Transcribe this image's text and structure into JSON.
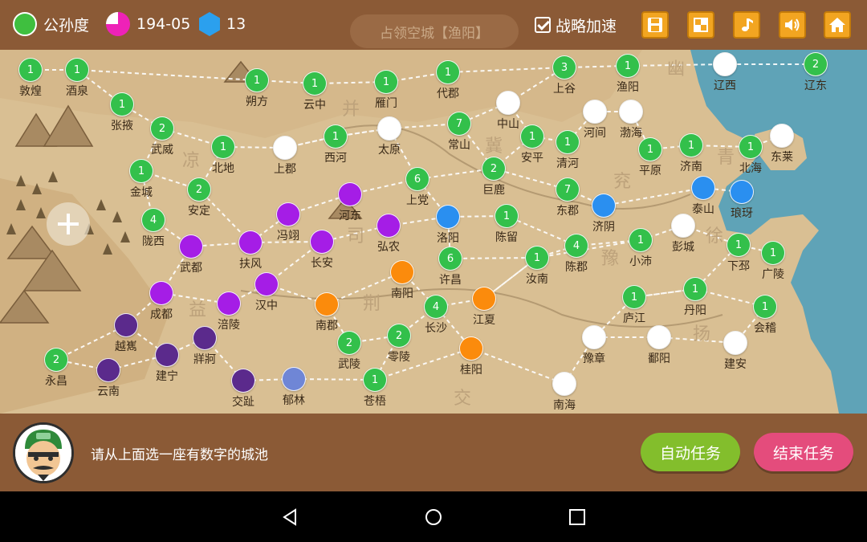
{
  "top": {
    "faction_name": "公孙度",
    "date": "194-05",
    "gems": "13",
    "command": "占领空城【渔阳】",
    "accelerate_label": "战略加速"
  },
  "toolbar_icons": [
    "save-icon",
    "layout-icon",
    "music-icon",
    "sound-icon",
    "home-icon"
  ],
  "bottom": {
    "hint": "请从上面选一座有数字的城池",
    "auto_task": "自动任务",
    "end_task": "结束任务"
  },
  "colors": {
    "player_green": "#33c04b",
    "neutral_white": "#ffffff",
    "purple": "#a51de6",
    "orange": "#fb8b0c",
    "blue": "#2a8ff0",
    "dark_purple": "#5b2a8c",
    "slate": "#6f86d6",
    "panel_brown": "#8b5a36"
  },
  "regions": [
    "幽",
    "并",
    "冀",
    "青",
    "凉",
    "兖",
    "司",
    "徐",
    "豫",
    "荆",
    "益",
    "扬",
    "交"
  ],
  "cities": [
    {
      "name": "敦煌",
      "owner": "green",
      "count": "1"
    },
    {
      "name": "酒泉",
      "owner": "green",
      "count": "1"
    },
    {
      "name": "张掖",
      "owner": "green",
      "count": "1"
    },
    {
      "name": "武威",
      "owner": "green",
      "count": "2"
    },
    {
      "name": "金城",
      "owner": "green",
      "count": "1"
    },
    {
      "name": "安定",
      "owner": "green",
      "count": "2"
    },
    {
      "name": "陇西",
      "owner": "green",
      "count": "4"
    },
    {
      "name": "北地",
      "owner": "green",
      "count": "1"
    },
    {
      "name": "上郡",
      "owner": "white",
      "count": ""
    },
    {
      "name": "朔方",
      "owner": "green",
      "count": "1"
    },
    {
      "name": "云中",
      "owner": "green",
      "count": "1"
    },
    {
      "name": "雁门",
      "owner": "green",
      "count": "1"
    },
    {
      "name": "代郡",
      "owner": "green",
      "count": "1"
    },
    {
      "name": "上谷",
      "owner": "green",
      "count": "3"
    },
    {
      "name": "渔阳",
      "owner": "green",
      "count": "1"
    },
    {
      "name": "辽西",
      "owner": "white",
      "count": ""
    },
    {
      "name": "辽东",
      "owner": "green",
      "count": "2"
    },
    {
      "name": "西河",
      "owner": "green",
      "count": "1"
    },
    {
      "name": "太原",
      "owner": "white",
      "count": ""
    },
    {
      "name": "常山",
      "owner": "green",
      "count": "7"
    },
    {
      "name": "中山",
      "owner": "white",
      "count": ""
    },
    {
      "name": "河间",
      "owner": "white",
      "count": ""
    },
    {
      "name": "渤海",
      "owner": "white",
      "count": ""
    },
    {
      "name": "安平",
      "owner": "green",
      "count": "1"
    },
    {
      "name": "清河",
      "owner": "green",
      "count": "1"
    },
    {
      "name": "平原",
      "owner": "green",
      "count": "1"
    },
    {
      "name": "济南",
      "owner": "green",
      "count": "1"
    },
    {
      "name": "北海",
      "owner": "green",
      "count": "1"
    },
    {
      "name": "东莱",
      "owner": "white",
      "count": ""
    },
    {
      "name": "上党",
      "owner": "green",
      "count": "6"
    },
    {
      "name": "巨鹿",
      "owner": "green",
      "count": "2"
    },
    {
      "name": "东郡",
      "owner": "green",
      "count": "7"
    },
    {
      "name": "泰山",
      "owner": "blue",
      "count": ""
    },
    {
      "name": "琅玡",
      "owner": "blue",
      "count": ""
    },
    {
      "name": "河东",
      "owner": "purple",
      "count": ""
    },
    {
      "name": "冯翊",
      "owner": "purple",
      "count": ""
    },
    {
      "name": "弘农",
      "owner": "purple",
      "count": ""
    },
    {
      "name": "洛阳",
      "owner": "blue",
      "count": ""
    },
    {
      "name": "陈留",
      "owner": "green",
      "count": "1"
    },
    {
      "name": "济阴",
      "owner": "blue",
      "count": ""
    },
    {
      "name": "彭城",
      "owner": "white",
      "count": ""
    },
    {
      "name": "武都",
      "owner": "purple",
      "count": ""
    },
    {
      "name": "扶风",
      "owner": "purple",
      "count": ""
    },
    {
      "name": "长安",
      "owner": "purple",
      "count": ""
    },
    {
      "name": "许昌",
      "owner": "green",
      "count": "6"
    },
    {
      "name": "陈郡",
      "owner": "green",
      "count": "4"
    },
    {
      "name": "小沛",
      "owner": "green",
      "count": "1"
    },
    {
      "name": "下邳",
      "owner": "green",
      "count": "1"
    },
    {
      "name": "广陵",
      "owner": "green",
      "count": "1"
    },
    {
      "name": "汝南",
      "owner": "green",
      "count": "1"
    },
    {
      "name": "汉中",
      "owner": "purple",
      "count": ""
    },
    {
      "name": "南阳",
      "owner": "orange",
      "count": ""
    },
    {
      "name": "成都",
      "owner": "purple",
      "count": ""
    },
    {
      "name": "涪陵",
      "owner": "purple",
      "count": ""
    },
    {
      "name": "南郡",
      "owner": "orange",
      "count": ""
    },
    {
      "name": "江夏",
      "owner": "orange",
      "count": ""
    },
    {
      "name": "长沙",
      "owner": "green",
      "count": "4"
    },
    {
      "name": "庐江",
      "owner": "green",
      "count": "1"
    },
    {
      "name": "丹阳",
      "owner": "green",
      "count": "1"
    },
    {
      "name": "会稽",
      "owner": "green",
      "count": "1"
    },
    {
      "name": "越嶲",
      "owner": "dpurple",
      "count": ""
    },
    {
      "name": "牂牁",
      "owner": "dpurple",
      "count": ""
    },
    {
      "name": "建宁",
      "owner": "dpurple",
      "count": ""
    },
    {
      "name": "永昌",
      "owner": "green",
      "count": "2"
    },
    {
      "name": "云南",
      "owner": "dpurple",
      "count": ""
    },
    {
      "name": "武陵",
      "owner": "green",
      "count": "2"
    },
    {
      "name": "零陵",
      "owner": "green",
      "count": "2"
    },
    {
      "name": "桂阳",
      "owner": "orange",
      "count": ""
    },
    {
      "name": "豫章",
      "owner": "white",
      "count": ""
    },
    {
      "name": "鄱阳",
      "owner": "white",
      "count": ""
    },
    {
      "name": "建安",
      "owner": "white",
      "count": ""
    },
    {
      "name": "交趾",
      "owner": "dpurple",
      "count": ""
    },
    {
      "name": "郁林",
      "owner": "slate",
      "count": ""
    },
    {
      "name": "苍梧",
      "owner": "green",
      "count": "1"
    },
    {
      "name": "南海",
      "owner": "white",
      "count": ""
    }
  ]
}
